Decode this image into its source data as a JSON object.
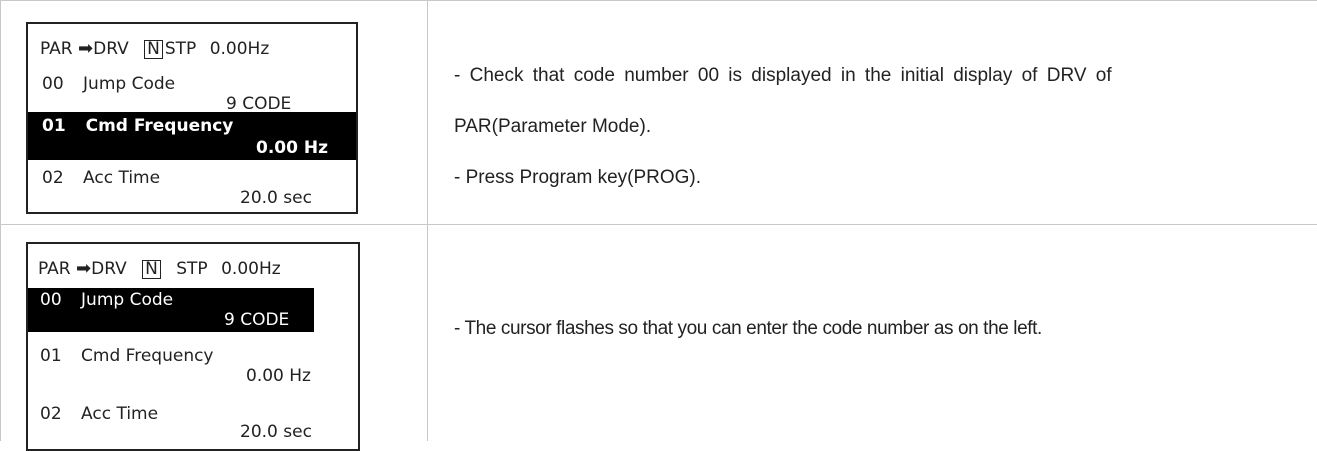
{
  "step1": {
    "lcd": {
      "head_mode": "PAR",
      "head_group": "DRV",
      "head_dir": "N",
      "head_state": "STP",
      "head_freq": "0.00Hz",
      "rows": [
        {
          "code": "00",
          "name": "Jump Code",
          "value": "9 CODE",
          "highlighted": false
        },
        {
          "code": "01",
          "name": "Cmd Frequency",
          "value": "0.00 Hz",
          "highlighted": true
        },
        {
          "code": "02",
          "name": "Acc  Time",
          "value": "20.0 sec",
          "highlighted": false
        }
      ]
    },
    "description": {
      "line1": "- Check that code number 00 is displayed in the initial display of DRV of",
      "line2": "PAR(Parameter Mode).",
      "line3": "- Press Program key(PROG)."
    }
  },
  "step2": {
    "lcd": {
      "head_mode": "PAR",
      "head_group": "DRV",
      "head_dir": "N",
      "head_state": "STP",
      "head_freq": "0.00Hz",
      "rows": [
        {
          "code": "00",
          "name": "Jump Code",
          "value": "9 CODE",
          "highlighted": true
        },
        {
          "code": "01",
          "name": "Cmd Frequency",
          "value": "0.00 Hz",
          "highlighted": false
        },
        {
          "code": "02",
          "name": "Acc  Time",
          "value": "20.0 sec",
          "highlighted": false
        }
      ]
    },
    "description": {
      "line1": "- The cursor flashes so that you can enter the code number as on the left."
    }
  },
  "colors": {
    "border": "#c8c8c8",
    "lcd_frame": "#222222",
    "highlight_bg": "#000000",
    "highlight_fg": "#ffffff"
  },
  "icons": {
    "arrow": "right-arrow-icon"
  }
}
